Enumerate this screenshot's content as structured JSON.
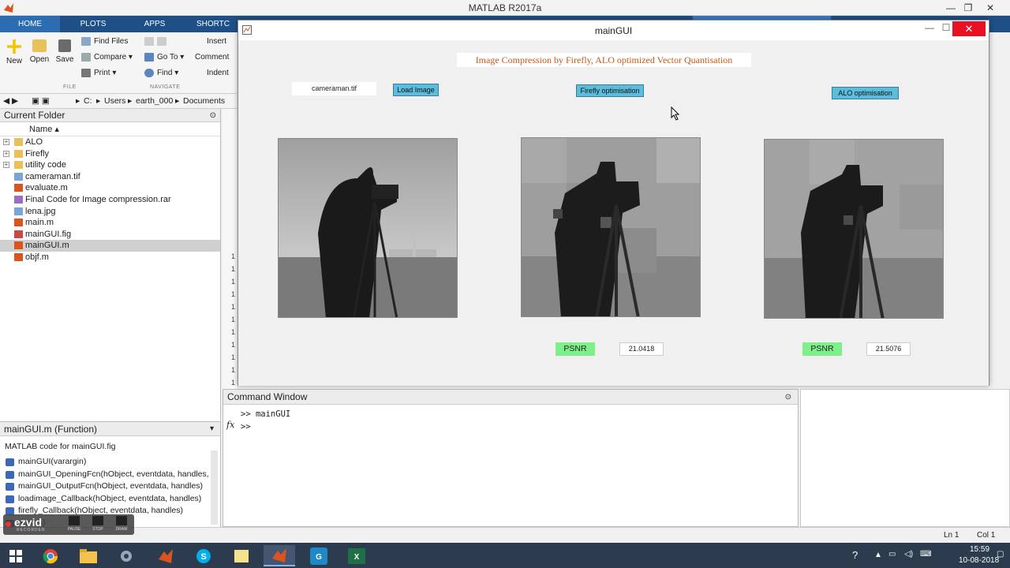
{
  "app": {
    "title": "MATLAB R2017a",
    "tabs": [
      "HOME",
      "PLOTS",
      "APPS",
      "SHORTC"
    ]
  },
  "ribbon": {
    "new": "New",
    "open": "Open",
    "save": "Save",
    "find_files": "Find Files",
    "compare": "Compare",
    "print": "Print",
    "go_to": "Go To",
    "find": "Find",
    "insert": "Insert",
    "comment": "Comment",
    "indent": "Indent",
    "group_file": "FILE",
    "group_navigate": "NAVIGATE"
  },
  "address": {
    "drive": "C:",
    "crumbs": [
      "Users",
      "earth_000",
      "Documents"
    ]
  },
  "current_folder": {
    "title": "Current Folder",
    "column_name": "Name ▴",
    "items": [
      {
        "name": "ALO",
        "type": "folder"
      },
      {
        "name": "Firefly",
        "type": "folder"
      },
      {
        "name": "utility code",
        "type": "folder"
      },
      {
        "name": "cameraman.tif",
        "type": "image"
      },
      {
        "name": "evaluate.m",
        "type": "mfile"
      },
      {
        "name": "Final Code for Image compression.rar",
        "type": "archive"
      },
      {
        "name": "lena.jpg",
        "type": "image"
      },
      {
        "name": "main.m",
        "type": "mfile"
      },
      {
        "name": "mainGUI.fig",
        "type": "fig"
      },
      {
        "name": "mainGUI.m",
        "type": "mfile"
      },
      {
        "name": "objf.m",
        "type": "mfile"
      }
    ],
    "selected_index": 9
  },
  "details": {
    "title": "mainGUI.m  (Function)",
    "description": "MATLAB code for mainGUI.fig",
    "functions": [
      "mainGUI(varargin)",
      "mainGUI_OpeningFcn(hObject, eventdata, handles, v...",
      "mainGUI_OutputFcn(hObject, eventdata, handles)",
      "loadimage_Callback(hObject, eventdata, handles)",
      "firefly_Callback(hObject, eventdata, handles)",
      "andles)"
    ]
  },
  "editor_line_numbers": [
    "1",
    "1",
    "1",
    "1",
    "1",
    "1",
    "1",
    "1",
    "1",
    "1",
    "1",
    "2"
  ],
  "command_window": {
    "title": "Command Window",
    "fx": "fx",
    "lines": [
      ">> mainGUI",
      ">>"
    ]
  },
  "status": {
    "ln": "Ln  1",
    "col": "Col  1"
  },
  "gui": {
    "title": "mainGUI",
    "headline": "Image Compression by Firefly, ALO optimized Vector Quantisation",
    "filename": "cameraman.tif",
    "load_button": "Load Image",
    "firefly_button": "Firefly optimisation",
    "alo_button": "ALO optimisation",
    "psnr_label": "PSNR",
    "firefly_psnr": "21.0418",
    "alo_psnr": "21.5076"
  },
  "ezvid": {
    "logo": "ezvid",
    "sub": "RECORDER",
    "pause": "PAUSE",
    "stop": "STOP",
    "draw": "DRAW"
  },
  "taskbar": {
    "time": "15:59",
    "date": "10-08-2018"
  }
}
